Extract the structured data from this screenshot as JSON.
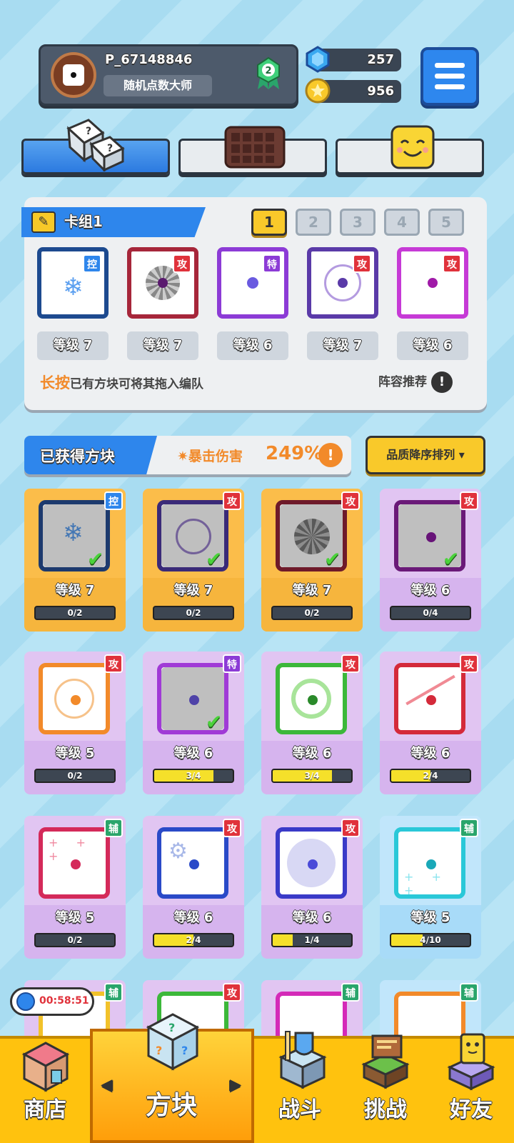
{
  "profile": {
    "name": "P_67148846",
    "title": "随机点数大师",
    "rank": "2"
  },
  "currency": {
    "gems": "257",
    "coins": "956"
  },
  "tabs": [
    "dice",
    "board",
    "emoji"
  ],
  "deck": {
    "name": "卡组1",
    "slots": [
      "1",
      "2",
      "3",
      "4",
      "5"
    ],
    "active_slot": "1",
    "cards": [
      {
        "tag": "控",
        "level": "等级 7"
      },
      {
        "tag": "攻",
        "level": "等级 7"
      },
      {
        "tag": "特",
        "level": "等级 6"
      },
      {
        "tag": "攻",
        "level": "等级 7"
      },
      {
        "tag": "攻",
        "level": "等级 6"
      }
    ],
    "hint_key": "长按",
    "hint_text": "已有方块可将其拖入编队",
    "recommend": "阵容推荐",
    "info": "!"
  },
  "owned": {
    "title": "已获得方块",
    "crit_label": "暴击伤害",
    "crit_value": "249%",
    "sort_label": "品质降序排列 ▾"
  },
  "grid": [
    {
      "tag": "控",
      "level": "等级 7",
      "progress": "0/2",
      "fill": 0
    },
    {
      "tag": "攻",
      "level": "等级 7",
      "progress": "0/2",
      "fill": 0
    },
    {
      "tag": "攻",
      "level": "等级 7",
      "progress": "0/2",
      "fill": 0
    },
    {
      "tag": "攻",
      "level": "等级 6",
      "progress": "0/4",
      "fill": 0
    },
    {
      "tag": "攻",
      "level": "等级 5",
      "progress": "0/2",
      "fill": 0
    },
    {
      "tag": "特",
      "level": "等级 6",
      "progress": "3/4",
      "fill": 0.75
    },
    {
      "tag": "攻",
      "level": "等级 6",
      "progress": "3/4",
      "fill": 0.75
    },
    {
      "tag": "攻",
      "level": "等级 6",
      "progress": "2/4",
      "fill": 0.5
    },
    {
      "tag": "辅",
      "level": "等级 5",
      "progress": "0/2",
      "fill": 0
    },
    {
      "tag": "攻",
      "level": "等级 6",
      "progress": "2/4",
      "fill": 0.5
    },
    {
      "tag": "攻",
      "level": "等级 6",
      "progress": "1/4",
      "fill": 0.25
    },
    {
      "tag": "辅",
      "level": "等级 5",
      "progress": "4/10",
      "fill": 0.4
    },
    {
      "tag": "辅"
    },
    {
      "tag": "攻"
    },
    {
      "tag": "辅"
    },
    {
      "tag": "辅"
    }
  ],
  "timer": "00:58:51",
  "nav": {
    "shop": "商店",
    "blocks": "方块",
    "battle": "战斗",
    "challenge": "挑战",
    "friends": "好友",
    "left": "◀",
    "right": "▶"
  }
}
